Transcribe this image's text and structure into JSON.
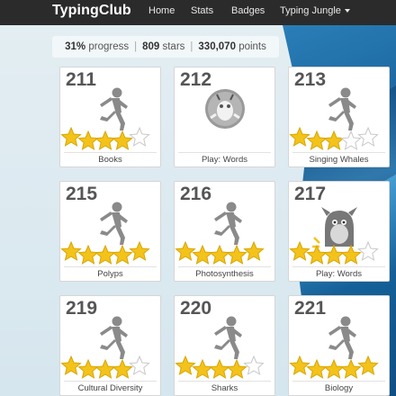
{
  "navbar": {
    "brand": "TypingClub",
    "links": [
      "Home",
      "Stats",
      "Badges",
      "Typing Jungle"
    ]
  },
  "progress": {
    "percent": "31%",
    "percent_label": "progress",
    "stars": "809",
    "stars_label": "stars",
    "points": "330,070",
    "points_label": "points"
  },
  "lessons": [
    {
      "num": "211",
      "label": "Books",
      "type": "runner",
      "stars": 5,
      "gold": 4
    },
    {
      "num": "212",
      "label": "Play: Words",
      "type": "game-creature",
      "stars": 0,
      "gold": 0
    },
    {
      "num": "213",
      "label": "Singing Whales",
      "type": "runner",
      "stars": 5,
      "gold": 3
    },
    {
      "num": "215",
      "label": "Polyps",
      "type": "runner",
      "stars": 5,
      "gold": 5
    },
    {
      "num": "216",
      "label": "Photosynthesis",
      "type": "runner",
      "stars": 5,
      "gold": 5
    },
    {
      "num": "217",
      "label": "Play: Words",
      "type": "game-monster",
      "stars": 5,
      "gold": 4
    },
    {
      "num": "219",
      "label": "Cultural Diversity",
      "type": "runner",
      "stars": 5,
      "gold": 4
    },
    {
      "num": "220",
      "label": "Sharks",
      "type": "runner",
      "stars": 5,
      "gold": 4
    },
    {
      "num": "221",
      "label": "Biology",
      "type": "runner",
      "stars": 5,
      "gold": 5
    }
  ],
  "colors": {
    "navbar": "#2b2b2b",
    "star_gold": "#f3c31b",
    "star_empty": "#ffffff",
    "figure_gray": "#8a8a8a"
  }
}
